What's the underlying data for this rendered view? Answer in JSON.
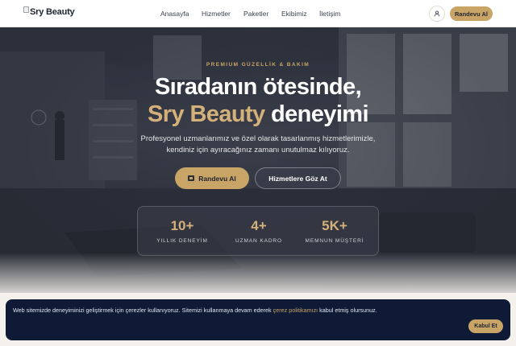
{
  "nav": {
    "logo_text": "Sry Beauty",
    "items": [
      "Anasayfa",
      "Hizmetler",
      "Paketler",
      "Ekibimiz",
      "İletişim"
    ],
    "cta_label": "Randevu Al",
    "user_icon": "user-icon"
  },
  "hero": {
    "eyebrow": "PREMIUM GÜZELLİK & BAKIM",
    "title_line1": "Sıradanın ötesinde,",
    "title_brand": "Sry Beauty",
    "title_rest": " deneyimi",
    "subtitle_line1": "Profesyonel uzmanlarımız ve özel olarak tasarlanmış hizmetlerimizle,",
    "subtitle_line2": "kendiniz için ayıracağınız zamanı unutulmaz kılıyoruz.",
    "primary_cta": "Randevu Al",
    "primary_icon": "calendar-icon",
    "secondary_cta": "Hizmetlere Göz At",
    "stats": [
      {
        "value": "10+",
        "label": "YILLIK DENEYİM"
      },
      {
        "value": "4+",
        "label": "UZMAN KADRO"
      },
      {
        "value": "5K+",
        "label": "MEMNUN MÜŞTERİ"
      }
    ]
  },
  "cookie": {
    "text_before": "Web sitemizde deneyiminizi geliştirmek için çerezler kullanıyoruz. Sitemizi kullanmaya devam ederek ",
    "link_text": "çerez politikamızı",
    "text_after": " kabul etmiş olursunuz.",
    "accept_label": "Kabul Et"
  },
  "colors": {
    "accent": "#c9a467",
    "cookie_bg": "#0f1a36",
    "nav_bg": "#ffffff"
  }
}
